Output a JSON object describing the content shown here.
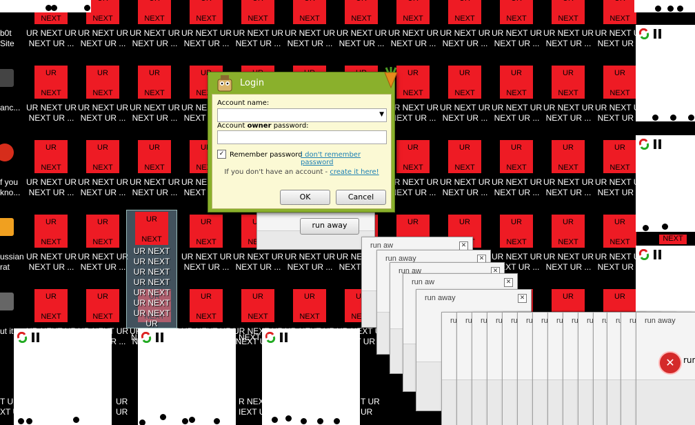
{
  "desktop_icon": {
    "img_top": "UR",
    "img_bottom": "NEXT",
    "label_line1": "UR NEXT UR",
    "label_line2": "NEXT UR ..."
  },
  "selected_icon": {
    "label": "UR NEXT UR NEXT UR NEXT UR NEXT UR NEXT UR NEXT UR NEXT UR"
  },
  "left_edge_labels": [
    "b0t",
    "Site",
    "anc...",
    "f you",
    "kno...",
    "ussian",
    "rat",
    "ut it..."
  ],
  "partial_next": "NEXT",
  "bottom_row_labels": {
    "a": "T UR",
    "b": "XT U",
    "c": "UR",
    "d": "UR",
    "e": "R NEX",
    "f": "IEXT U",
    "g": "T UR",
    "h": "UR",
    "i": "UR",
    "j": "N",
    "k": "NEXT U"
  },
  "login": {
    "title": "Login",
    "account_name_label": "Account name:",
    "password_label_pre": "Account ",
    "password_label_bold": "owner",
    "password_label_post": " password:",
    "remember_label": "Remember password",
    "forgot_link": "I don't remember password",
    "no_account_text": "If you don't have an account - ",
    "create_link": "create it here!",
    "ok_label": "OK",
    "cancel_label": "Cancel",
    "remember_checked": true
  },
  "run_away": {
    "title": "run away",
    "title_short": "run a",
    "button": "run away",
    "partial": "run aw",
    "partial2": "run",
    "partial3": "ru"
  },
  "colors": {
    "icon_red": "#ee1b24",
    "login_green": "#8ab02c",
    "login_body": "#fbf9d4"
  }
}
